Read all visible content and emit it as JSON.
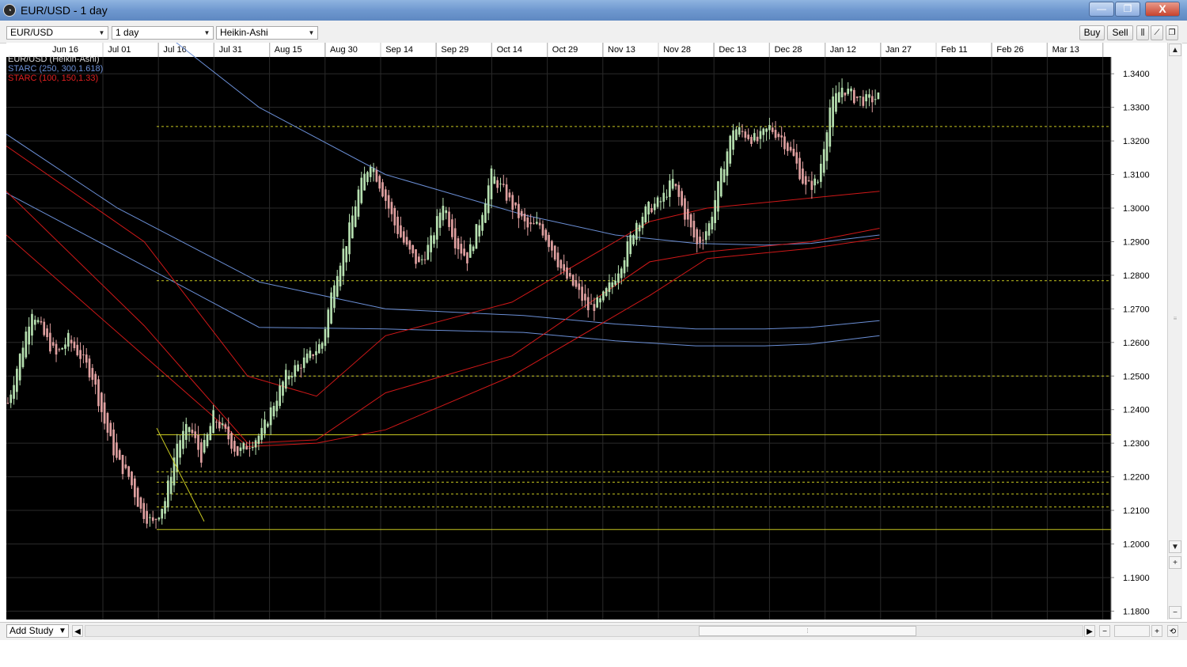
{
  "window": {
    "title": "EUR/USD - 1 day",
    "min_label": "—",
    "max_label": "❐",
    "close_label": "X"
  },
  "toolbar": {
    "symbol_value": "EUR/USD",
    "interval_value": "1 day",
    "chart_style_value": "Heikin-Ashi",
    "buy_label": "Buy",
    "sell_label": "Sell"
  },
  "legend": [
    {
      "label": "EUR/USD (Heikin-Ashi)",
      "color": "#e0e0e0"
    },
    {
      "label": "STARC (250, 300,1.618)",
      "color": "#6b8fd6"
    },
    {
      "label": "STARC (100, 150,1.33)",
      "color": "#e02020"
    }
  ],
  "statusbar": {
    "add_study_label": "Add Study"
  },
  "colors": {
    "background": "#000000",
    "grid": "#2a2a2a",
    "bull_candle": "#b6e0b0",
    "bear_candle": "#e0a0a0",
    "starc_long": "#6b8fd6",
    "starc_short": "#d01818",
    "fib_lines": "#c8c820"
  },
  "chart_data": {
    "type": "candlestick",
    "title": "EUR/USD - 1 day",
    "x_ticks": [
      "Jun 16",
      "Jul 01",
      "Jul 16",
      "Jul 31",
      "Aug 15",
      "Aug 30",
      "Sep 14",
      "Sep 29",
      "Oct 14",
      "Oct 29",
      "Nov 13",
      "Nov 28",
      "Dec 13",
      "Dec 28",
      "Jan 12",
      "Jan 27",
      "Feb 11",
      "Feb 26",
      "Mar 13"
    ],
    "y_ticks": [
      "1.3400",
      "1.3300",
      "1.3200",
      "1.3100",
      "1.3000",
      "1.2900",
      "1.2800",
      "1.2700",
      "1.2600",
      "1.2500",
      "1.2400",
      "1.2300",
      "1.2200",
      "1.2100",
      "1.2000",
      "1.1900",
      "1.1800"
    ],
    "ylim": [
      1.1775,
      1.345
    ],
    "horizontal_levels": [
      {
        "value": 1.3243,
        "style": "dotted"
      },
      {
        "value": 1.2784,
        "style": "dotted"
      },
      {
        "value": 1.25,
        "style": "dotted"
      },
      {
        "value": 1.2325,
        "style": "solid"
      },
      {
        "value": 1.2215,
        "style": "dotted"
      },
      {
        "value": 1.2184,
        "style": "dotted"
      },
      {
        "value": 1.2149,
        "style": "dotted"
      },
      {
        "value": 1.211,
        "style": "dotted"
      },
      {
        "value": 1.2043,
        "style": "solid"
      }
    ],
    "price_path": [
      1.242,
      1.256,
      1.27,
      1.262,
      1.256,
      1.261,
      1.256,
      1.25,
      1.236,
      1.225,
      1.22,
      1.21,
      1.206,
      1.213,
      1.23,
      1.235,
      1.226,
      1.238,
      1.233,
      1.227,
      1.23,
      1.233,
      1.242,
      1.25,
      1.253,
      1.256,
      1.26,
      1.279,
      1.29,
      1.305,
      1.314,
      1.305,
      1.295,
      1.288,
      1.283,
      1.29,
      1.302,
      1.29,
      1.285,
      1.296,
      1.31,
      1.305,
      1.299,
      1.294,
      1.295,
      1.288,
      1.28,
      1.276,
      1.27,
      1.272,
      1.278,
      1.286,
      1.296,
      1.3,
      1.302,
      1.308,
      1.298,
      1.289,
      1.295,
      1.31,
      1.324,
      1.322,
      1.32,
      1.324,
      1.321,
      1.315,
      1.306,
      1.308,
      1.33,
      1.336,
      1.333,
      1.332,
      1.333
    ],
    "starc_long_bands": [
      {
        "x": [
          0,
          0.0967,
          0.22,
          0.33,
          0.45,
          0.53,
          0.6,
          0.66,
          0.7,
          0.76
        ],
        "y": [
          1.385,
          1.363,
          1.33,
          1.31,
          1.298,
          1.292,
          1.2895,
          1.289,
          1.2895,
          1.292
        ]
      },
      {
        "x": [
          0,
          0.0967,
          0.22,
          0.33,
          0.45,
          0.53,
          0.6,
          0.66,
          0.7,
          0.76
        ],
        "y": [
          1.322,
          1.3,
          1.278,
          1.27,
          1.268,
          1.2655,
          1.264,
          1.264,
          1.2645,
          1.2665
        ]
      },
      {
        "x": [
          0,
          0.0967,
          0.22,
          0.33,
          0.45,
          0.53,
          0.6,
          0.66,
          0.7,
          0.76
        ],
        "y": [
          1.3045,
          1.287,
          1.2645,
          1.264,
          1.263,
          1.2605,
          1.259,
          1.259,
          1.2595,
          1.262
        ]
      }
    ],
    "starc_short_bands": [
      {
        "x": [
          0,
          0.12,
          0.21,
          0.27,
          0.33,
          0.44,
          0.56,
          0.61,
          0.7,
          0.76
        ],
        "y": [
          1.3185,
          1.29,
          1.25,
          1.244,
          1.262,
          1.272,
          1.296,
          1.3,
          1.303,
          1.305
        ]
      },
      {
        "x": [
          0,
          0.12,
          0.21,
          0.27,
          0.33,
          0.44,
          0.56,
          0.61,
          0.7,
          0.76
        ],
        "y": [
          1.305,
          1.265,
          1.23,
          1.231,
          1.245,
          1.256,
          1.284,
          1.287,
          1.29,
          1.294
        ]
      },
      {
        "x": [
          0,
          0.12,
          0.21,
          0.27,
          0.33,
          0.44,
          0.56,
          0.61,
          0.7,
          0.76
        ],
        "y": [
          1.292,
          1.256,
          1.229,
          1.23,
          1.234,
          1.25,
          1.274,
          1.285,
          1.288,
          1.291
        ]
      }
    ]
  }
}
